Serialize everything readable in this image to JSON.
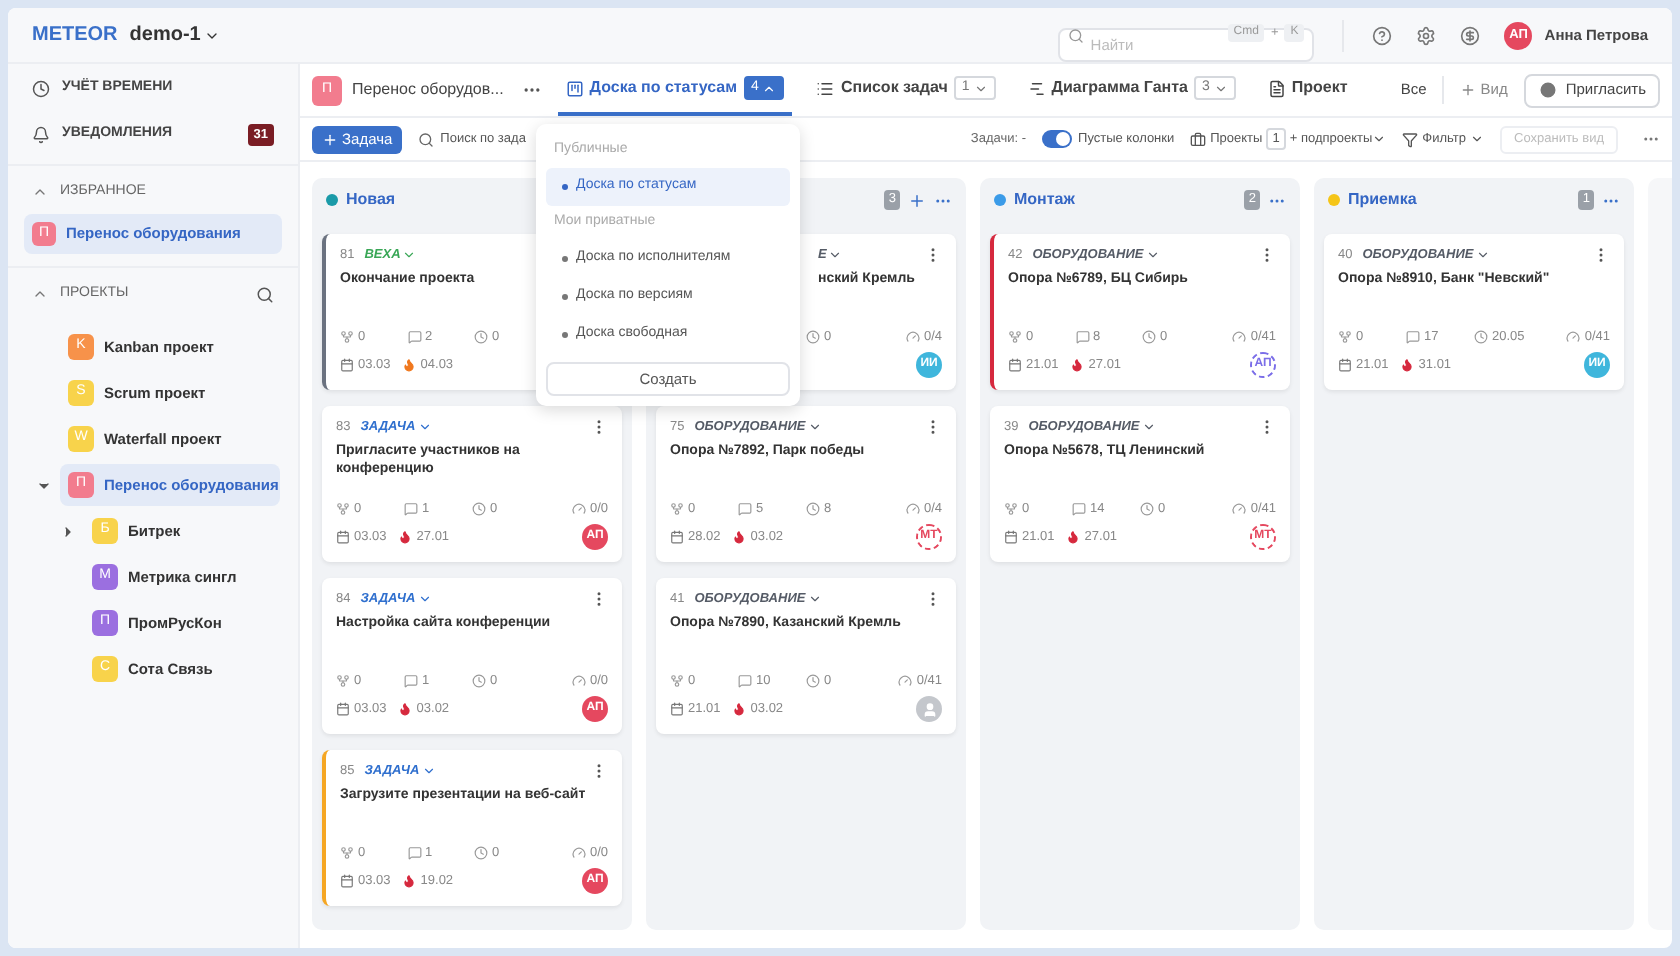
{
  "topbar": {
    "brand": "METEOR",
    "workspace": "demo-1",
    "search": {
      "placeholder": "Найти",
      "shortcut": [
        "Cmd",
        "+",
        "K"
      ]
    },
    "user": {
      "initials": "АП",
      "name": "Анна Петрова",
      "color": "#e5485f"
    }
  },
  "sidebar": {
    "nav": [
      {
        "kind": "time",
        "label": "УЧЁТ ВРЕМЕНИ"
      },
      {
        "kind": "bell",
        "label": "УВЕДОМЛЕНИЯ",
        "badge": "31"
      }
    ],
    "favorites": {
      "title": "ИЗБРАННОЕ",
      "expanded": true,
      "items": [
        {
          "letter": "П",
          "label": "Перенос оборудования",
          "color": "#f27c8e",
          "selected": true
        }
      ]
    },
    "projects": {
      "title": "ПРОЕКТЫ",
      "expanded": true,
      "items": [
        {
          "letter": "K",
          "label": "Kanban проект",
          "color": "#f7924a",
          "selected": false
        },
        {
          "letter": "S",
          "label": "Scrum проект",
          "color": "#f8d34b",
          "selected": false
        },
        {
          "letter": "W",
          "label": "Waterfall проект",
          "color": "#f8d34b",
          "selected": false
        },
        {
          "letter": "П",
          "label": "Перенос оборудования",
          "color": "#f27c8e",
          "selected": true,
          "expanded": true,
          "children": [
            {
              "letter": "Б",
              "label": "Битрек",
              "color": "#f8d34b",
              "selected": false,
              "expanded": false
            },
            {
              "letter": "М",
              "label": "Метрика сингл",
              "color": "#9b6fe0",
              "selected": false
            },
            {
              "letter": "П",
              "label": "ПромРусКон",
              "color": "#9b6fe0",
              "selected": false
            },
            {
              "letter": "С",
              "label": "Сота Связь",
              "color": "#f8d34b",
              "selected": false
            }
          ]
        }
      ]
    }
  },
  "tabs": {
    "project": {
      "letter": "П",
      "label": "Перенос оборудов...",
      "color": "#f27c8e"
    },
    "views": [
      {
        "kind": "board",
        "label": "Доска по статусам",
        "count": "4",
        "selected": true,
        "expanded": true
      },
      {
        "kind": "list",
        "label": "Список задач",
        "count": "1",
        "selected": false,
        "expanded": false
      },
      {
        "kind": "gantt",
        "label": "Диаграмма Ганта",
        "count": "3",
        "selected": false,
        "expanded": false
      },
      {
        "kind": "project",
        "label": "Проект",
        "selected": false
      }
    ],
    "all": "Все",
    "add_view": "Вид",
    "invite": "Пригласить"
  },
  "toolbar": {
    "add_task": "Задача",
    "search_placeholder": "Поиск по зада",
    "tasks_label": "Задачи: -",
    "empty_columns": {
      "label": "Пустые колонки",
      "on": true
    },
    "projects": {
      "label": "Проекты",
      "count": "1",
      "suffix": "+ подпроекты"
    },
    "filter": "Фильтр",
    "save_view": {
      "label": "Сохранить вид",
      "disabled": true
    }
  },
  "view_menu": {
    "sections": [
      {
        "title": "Публичные",
        "items": [
          {
            "label": "Доска по статусам",
            "selected": true
          }
        ]
      },
      {
        "title": "Мои приватные",
        "items": [
          {
            "label": "Доска по исполнителям",
            "selected": false
          },
          {
            "label": "Доска по версиям",
            "selected": false
          },
          {
            "label": "Доска свободная",
            "selected": false
          }
        ]
      }
    ],
    "create": "Создать"
  },
  "columns": [
    {
      "name": "Новая",
      "color": "#1a9aa8",
      "cards": [
        {
          "number": "81",
          "type": "ВЕХА",
          "kind": "milestone",
          "title": "Окончание проекта",
          "color": "#6b7280",
          "stats": [
            {
              "kind": "subtasks",
              "value": "0"
            },
            {
              "kind": "comments",
              "value": "2"
            },
            {
              "kind": "time",
              "value": "0"
            }
          ],
          "start": "03.03",
          "due": "04.03",
          "overdue": false
        },
        {
          "number": "83",
          "type": "ЗАДАЧА",
          "kind": "task",
          "title": "Пригласите участников на конференцию",
          "stats": [
            {
              "kind": "subtasks",
              "value": "0"
            },
            {
              "kind": "comments",
              "value": "1"
            },
            {
              "kind": "time",
              "value": "0"
            },
            {
              "kind": "progress",
              "value": "0/0"
            }
          ],
          "start": "03.03",
          "due": "27.01",
          "overdue": true,
          "assignee": {
            "initials": "АП",
            "kind": "member",
            "color": "#e5485f"
          }
        },
        {
          "number": "84",
          "type": "ЗАДАЧА",
          "kind": "task",
          "title": "Настройка сайта конференции",
          "stats": [
            {
              "kind": "subtasks",
              "value": "0"
            },
            {
              "kind": "comments",
              "value": "1"
            },
            {
              "kind": "time",
              "value": "0"
            },
            {
              "kind": "progress",
              "value": "0/0"
            }
          ],
          "start": "03.03",
          "due": "03.02",
          "overdue": true,
          "assignee": {
            "initials": "АП",
            "kind": "member",
            "color": "#e5485f"
          }
        },
        {
          "number": "85",
          "type": "ЗАДАЧА",
          "kind": "task",
          "title": "Загрузите презентации на веб-сайт",
          "color": "#f5a623",
          "stats": [
            {
              "kind": "subtasks",
              "value": "0"
            },
            {
              "kind": "comments",
              "value": "1"
            },
            {
              "kind": "time",
              "value": "0"
            },
            {
              "kind": "progress",
              "value": "0/0"
            }
          ],
          "start": "03.03",
          "due": "19.02",
          "overdue": true,
          "assignee": {
            "initials": "АП",
            "kind": "member",
            "color": "#e5485f"
          }
        }
      ]
    },
    {
      "count": "3",
      "can_add": true,
      "cards": [
        {
          "partial": true,
          "type": "Е",
          "kind": "equipment",
          "title": "нский Кремль",
          "stats": [
            {
              "kind": "time",
              "value": "0"
            },
            {
              "kind": "progress",
              "value": "0/4"
            }
          ],
          "assignee": {
            "initials": "ИИ",
            "kind": "member",
            "color": "#3fb6dc"
          }
        },
        {
          "number": "75",
          "type": "ОБОРУДОВАНИЕ",
          "kind": "equipment",
          "title": "Опора №7892, Парк победы",
          "stats": [
            {
              "kind": "subtasks",
              "value": "0"
            },
            {
              "kind": "comments",
              "value": "5"
            },
            {
              "kind": "time",
              "value": "8"
            },
            {
              "kind": "progress",
              "value": "0/4"
            }
          ],
          "start": "28.02",
          "due": "03.02",
          "overdue": true,
          "assignee": {
            "initials": "МТ",
            "kind": "observer",
            "color": "#e5485f"
          }
        },
        {
          "number": "41",
          "type": "ОБОРУДОВАНИЕ",
          "kind": "equipment",
          "title": "Опора №7890, Казанский Кремль",
          "stats": [
            {
              "kind": "subtasks",
              "value": "0"
            },
            {
              "kind": "comments",
              "value": "10"
            },
            {
              "kind": "time",
              "value": "0"
            },
            {
              "kind": "progress",
              "value": "0/41"
            }
          ],
          "start": "21.01",
          "due": "03.02",
          "overdue": true,
          "assignee": {
            "kind": "unassigned"
          }
        }
      ]
    },
    {
      "name": "Монтаж",
      "color": "#3b9be8",
      "count": "2",
      "cards": [
        {
          "number": "42",
          "type": "ОБОРУДОВАНИЕ",
          "kind": "equipment",
          "title": "Опора №6789, БЦ Сибирь",
          "color": "#d6293e",
          "stats": [
            {
              "kind": "subtasks",
              "value": "0"
            },
            {
              "kind": "comments",
              "value": "8"
            },
            {
              "kind": "time",
              "value": "0"
            },
            {
              "kind": "progress",
              "value": "0/41"
            }
          ],
          "start": "21.01",
          "due": "27.01",
          "overdue": true,
          "assignee": {
            "initials": "АП",
            "kind": "observer",
            "color": "#7b6ee8"
          }
        },
        {
          "number": "39",
          "type": "ОБОРУДОВАНИЕ",
          "kind": "equipment",
          "title": "Опора №5678, ТЦ Ленинский",
          "stats": [
            {
              "kind": "subtasks",
              "value": "0"
            },
            {
              "kind": "comments",
              "value": "14"
            },
            {
              "kind": "time",
              "value": "0"
            },
            {
              "kind": "progress",
              "value": "0/41"
            }
          ],
          "start": "21.01",
          "due": "27.01",
          "overdue": true,
          "assignee": {
            "initials": "МТ",
            "kind": "observer",
            "color": "#e5485f"
          }
        }
      ]
    },
    {
      "name": "Приемка",
      "color": "#f5c518",
      "count": "1",
      "cards": [
        {
          "number": "40",
          "type": "ОБОРУДОВАНИЕ",
          "kind": "equipment",
          "title": "Опора №8910, Банк \"Невский\"",
          "stats": [
            {
              "kind": "subtasks",
              "value": "0"
            },
            {
              "kind": "comments",
              "value": "17"
            },
            {
              "kind": "time",
              "value": "20.05"
            },
            {
              "kind": "progress",
              "value": "0/41"
            }
          ],
          "start": "21.01",
          "due": "31.01",
          "overdue": true,
          "assignee": {
            "initials": "ИИ",
            "kind": "member",
            "color": "#3fb6dc"
          }
        }
      ]
    },
    {
      "empty": true
    }
  ]
}
